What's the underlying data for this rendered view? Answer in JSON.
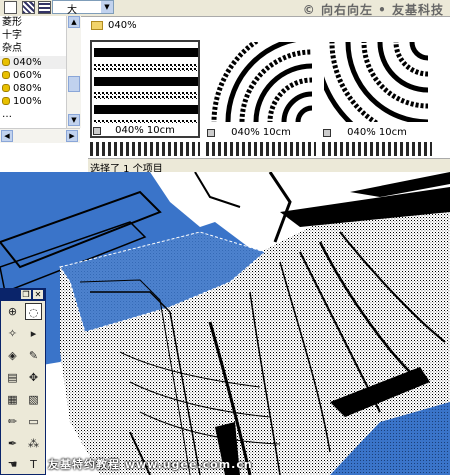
{
  "toolbar": {
    "size_value": "大",
    "icons": [
      "edit-icon",
      "grid-view-icon",
      "list-view-icon"
    ]
  },
  "watermark_top": "© 向右向左 • 友基科技",
  "list": {
    "items": [
      {
        "label": "菱形",
        "icon": ""
      },
      {
        "label": "十字",
        "icon": ""
      },
      {
        "label": "杂点",
        "icon": ""
      },
      {
        "label": "040%",
        "icon": "dot-icon"
      },
      {
        "label": "060%",
        "icon": "dot-icon"
      },
      {
        "label": "080%",
        "icon": "dot-icon"
      },
      {
        "label": "100%",
        "icon": "dot-icon"
      },
      {
        "label": "…",
        "icon": ""
      }
    ],
    "selected_index": 3
  },
  "folder": {
    "name": "040%"
  },
  "thumbnails": [
    {
      "label": "040% 10cm",
      "pattern": "horizontal-lines",
      "selected": true
    },
    {
      "label": "040% 10cm",
      "pattern": "concentric-arcs",
      "selected": false
    },
    {
      "label": "040% 10cm",
      "pattern": "concentric-arcs",
      "selected": false
    }
  ],
  "status_text": "选择了 1 个项目",
  "watermark_bottom": "友基特约教程 www.ugee.com.cn",
  "colors": {
    "accent_blue": "#3a74c9",
    "titlebar": "#0a246a",
    "chrome": "#ece9d8"
  }
}
